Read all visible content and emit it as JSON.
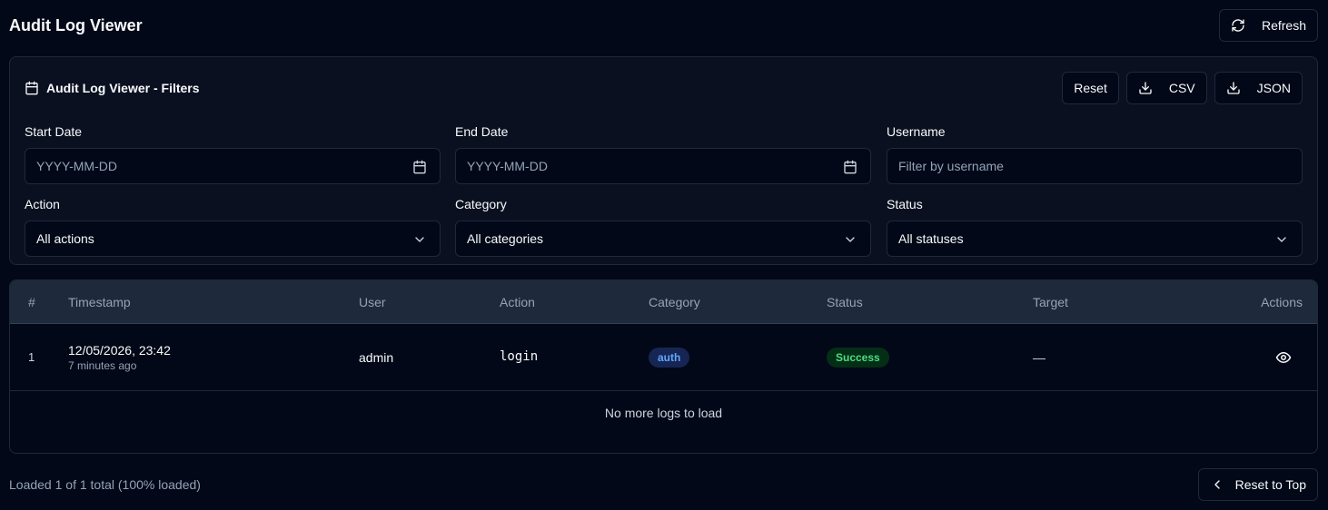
{
  "header": {
    "title": "Audit Log Viewer",
    "refresh_label": "Refresh"
  },
  "filters": {
    "title": "Audit Log Viewer - Filters",
    "reset_label": "Reset",
    "csv_label": "CSV",
    "json_label": "JSON",
    "start_date": {
      "label": "Start Date",
      "placeholder": "YYYY-MM-DD"
    },
    "end_date": {
      "label": "End Date",
      "placeholder": "YYYY-MM-DD"
    },
    "username": {
      "label": "Username",
      "placeholder": "Filter by username"
    },
    "action": {
      "label": "Action",
      "value": "All actions"
    },
    "category": {
      "label": "Category",
      "value": "All categories"
    },
    "status": {
      "label": "Status",
      "value": "All statuses"
    }
  },
  "table": {
    "columns": [
      "#",
      "Timestamp",
      "User",
      "Action",
      "Category",
      "Status",
      "Target",
      "Actions"
    ],
    "rows": [
      {
        "index": "1",
        "timestamp": "12/05/2026, 23:42",
        "relative": "7 minutes ago",
        "user": "admin",
        "action": "login",
        "category": "auth",
        "status": "Success",
        "target": "—"
      }
    ],
    "end_message": "No more logs to load"
  },
  "footer": {
    "status": "Loaded 1 of 1 total (100% loaded)",
    "reset_top_label": "Reset to Top"
  },
  "colors": {
    "background": "#020817",
    "border": "#1e293b",
    "success": "#4ade80",
    "auth": "#60a5fa"
  }
}
